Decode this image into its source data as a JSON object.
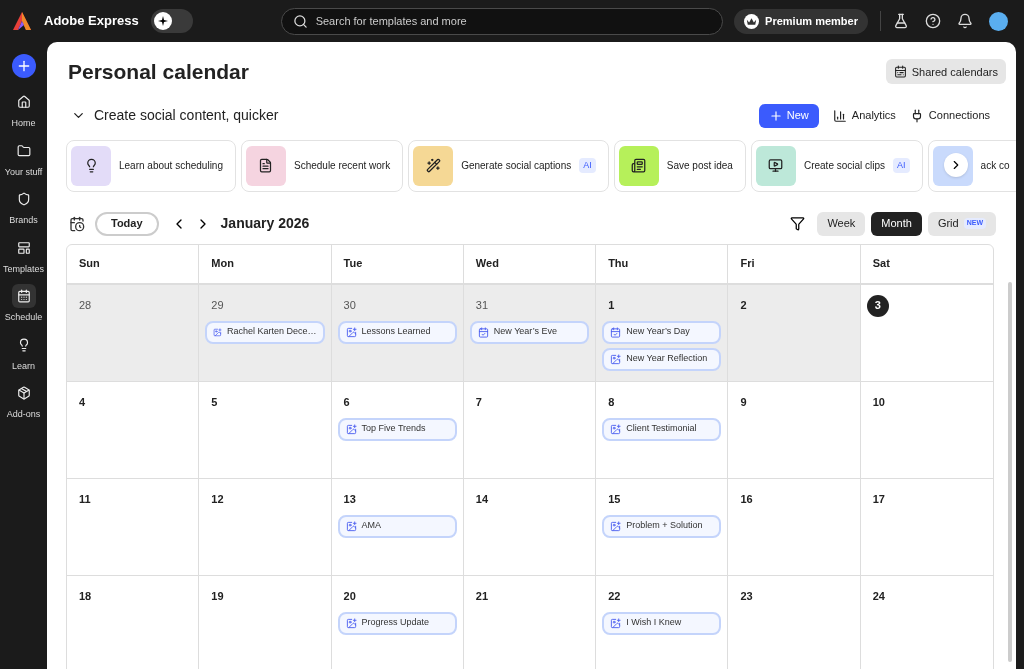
{
  "app": {
    "name": "Adobe Express"
  },
  "mode_toggle": {
    "on": false
  },
  "search": {
    "placeholder": "Search for templates and more"
  },
  "premium": {
    "label": "Premium member"
  },
  "sidebar": {
    "items": [
      {
        "label": "Home",
        "selected": false
      },
      {
        "label": "Your stuff",
        "selected": false
      },
      {
        "label": "Brands",
        "selected": false
      },
      {
        "label": "Templates",
        "selected": false
      },
      {
        "label": "Schedule",
        "selected": true
      },
      {
        "label": "Learn",
        "selected": false
      },
      {
        "label": "Add-ons",
        "selected": false
      }
    ]
  },
  "page": {
    "title": "Personal calendar",
    "shared_button": "Shared calendars"
  },
  "quick": {
    "title": "Create social content, quicker",
    "expanded": true,
    "actions": [
      {
        "label": "New",
        "kind": "primary"
      },
      {
        "label": "Analytics",
        "kind": "analytics"
      },
      {
        "label": "Connections",
        "kind": "connections"
      }
    ],
    "cards": [
      {
        "label": "Learn about scheduling",
        "color": "#e3dcf8"
      },
      {
        "label": "Schedule recent work",
        "color": "#f5d4e0"
      },
      {
        "label": "Generate social captions",
        "color": "#f5d895",
        "badge": "AI"
      },
      {
        "label": "Save post idea",
        "color": "#b6f05a"
      },
      {
        "label": "Create social clips",
        "color": "#bde8d9",
        "badge": "AI"
      },
      {
        "label": "ack co",
        "color": "#c9dafc"
      }
    ]
  },
  "toolbar": {
    "today": "Today",
    "month_label": "January 2026",
    "views": [
      {
        "label": "Week",
        "selected": false
      },
      {
        "label": "Month",
        "selected": true
      },
      {
        "label": "Grid",
        "selected": false,
        "badge": "NEW"
      }
    ]
  },
  "calendar": {
    "weekdays": [
      "Sun",
      "Mon",
      "Tue",
      "Wed",
      "Thu",
      "Fri",
      "Sat"
    ],
    "weeks": [
      [
        {
          "day": "28",
          "in_month": false,
          "past": true,
          "today": false
        },
        {
          "day": "29",
          "in_month": false,
          "past": true,
          "today": false,
          "events": [
            {
              "kind": "post",
              "title": "Rachel Karten Dece…"
            }
          ]
        },
        {
          "day": "30",
          "in_month": false,
          "past": true,
          "today": false,
          "events": [
            {
              "kind": "post",
              "title": "Lessons Learned"
            }
          ]
        },
        {
          "day": "31",
          "in_month": false,
          "past": true,
          "today": false,
          "events": [
            {
              "kind": "holiday",
              "title": "New Year’s Eve"
            }
          ]
        },
        {
          "day": "1",
          "in_month": true,
          "past": true,
          "today": false,
          "events": [
            {
              "kind": "holiday",
              "title": "New Year’s Day"
            },
            {
              "kind": "post",
              "title": "New Year Reflection"
            }
          ]
        },
        {
          "day": "2",
          "in_month": true,
          "past": true,
          "today": false
        },
        {
          "day": "3",
          "in_month": true,
          "past": false,
          "today": true
        }
      ],
      [
        {
          "day": "4",
          "in_month": true,
          "past": false,
          "today": false
        },
        {
          "day": "5",
          "in_month": true,
          "past": false,
          "today": false
        },
        {
          "day": "6",
          "in_month": true,
          "past": false,
          "today": false,
          "events": [
            {
              "kind": "post",
              "title": "Top Five Trends"
            }
          ]
        },
        {
          "day": "7",
          "in_month": true,
          "past": false,
          "today": false
        },
        {
          "day": "8",
          "in_month": true,
          "past": false,
          "today": false,
          "events": [
            {
              "kind": "post",
              "title": "Client Testimonial"
            }
          ]
        },
        {
          "day": "9",
          "in_month": true,
          "past": false,
          "today": false
        },
        {
          "day": "10",
          "in_month": true,
          "past": false,
          "today": false
        }
      ],
      [
        {
          "day": "11",
          "in_month": true,
          "past": false,
          "today": false
        },
        {
          "day": "12",
          "in_month": true,
          "past": false,
          "today": false
        },
        {
          "day": "13",
          "in_month": true,
          "past": false,
          "today": false,
          "events": [
            {
              "kind": "post",
              "title": "AMA"
            }
          ]
        },
        {
          "day": "14",
          "in_month": true,
          "past": false,
          "today": false
        },
        {
          "day": "15",
          "in_month": true,
          "past": false,
          "today": false,
          "events": [
            {
              "kind": "post",
              "title": "Problem + Solution"
            }
          ]
        },
        {
          "day": "16",
          "in_month": true,
          "past": false,
          "today": false
        },
        {
          "day": "17",
          "in_month": true,
          "past": false,
          "today": false
        }
      ],
      [
        {
          "day": "18",
          "in_month": true,
          "past": false,
          "today": false
        },
        {
          "day": "19",
          "in_month": true,
          "past": false,
          "today": false
        },
        {
          "day": "20",
          "in_month": true,
          "past": false,
          "today": false,
          "events": [
            {
              "kind": "post",
              "title": "Progress Update"
            }
          ]
        },
        {
          "day": "21",
          "in_month": true,
          "past": false,
          "today": false
        },
        {
          "day": "22",
          "in_month": true,
          "past": false,
          "today": false,
          "events": [
            {
              "kind": "post",
              "title": "I Wish I Knew"
            }
          ]
        },
        {
          "day": "23",
          "in_month": true,
          "past": false,
          "today": false
        },
        {
          "day": "24",
          "in_month": true,
          "past": false,
          "today": false
        }
      ]
    ]
  }
}
